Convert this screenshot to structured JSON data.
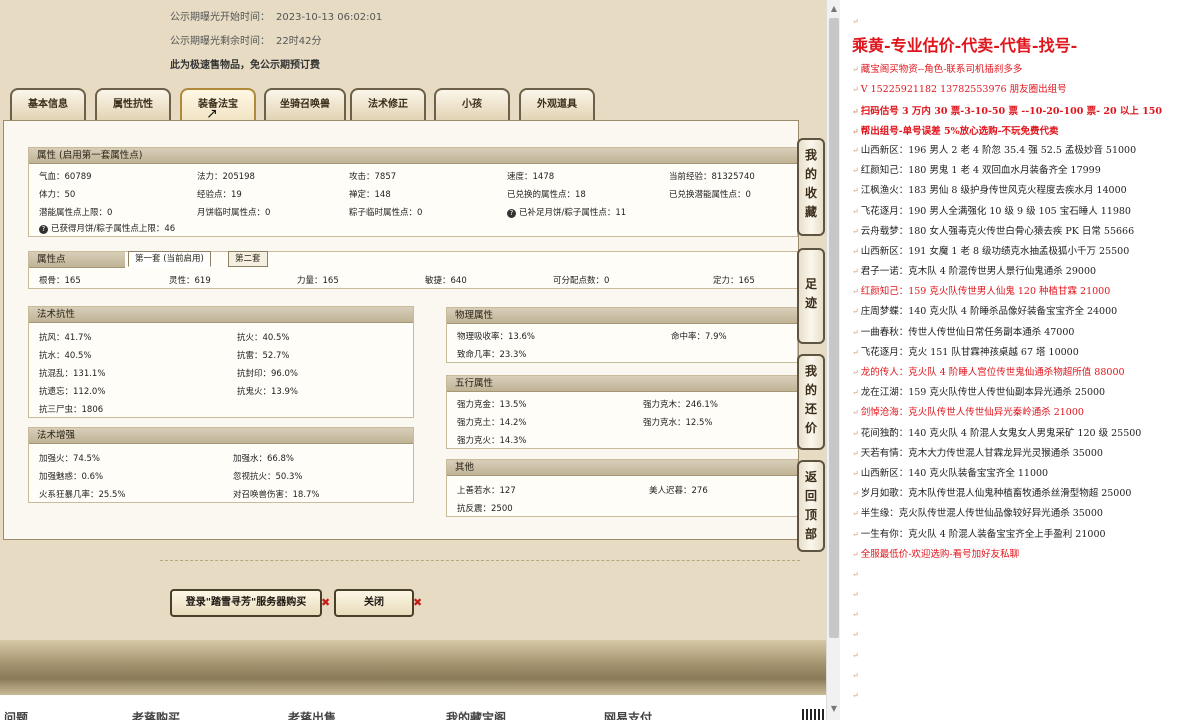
{
  "header": {
    "start_label": "公示期曝光开始时间：",
    "start_value": "2023-10-13 06:02:01",
    "remain_label": "公示期曝光剩余时间：",
    "remain_value": "22时42分",
    "note": "此为极速售物品，免公示期预订费"
  },
  "tabs": [
    "基本信息",
    "属性抗性",
    "装备法宝",
    "坐骑召唤兽",
    "法术修正",
    "小孩",
    "外观道具"
  ],
  "attr": {
    "title": "属性 (启用第一套属性点)",
    "row1": [
      "气血：60789",
      "法力：205198",
      "攻击：7857",
      "速度：1478",
      "当前经验：81325740"
    ],
    "row2": [
      "体力：50",
      "经验点：19",
      "禅定：148",
      "已兑换的属性点：18",
      "已兑换潜能属性点：0"
    ],
    "row3": [
      "潜能属性点上限：0",
      "月饼临时属性点：0",
      "粽子临时属性点：0",
      "已补足月饼/粽子属性点：11"
    ],
    "row4": "已获得月饼/粽子属性点上限：46"
  },
  "points": {
    "title": "属性点",
    "tab1": "第一套 (当前启用)",
    "tab2": "第二套",
    "row": [
      "根骨：165",
      "灵性：619",
      "力量：165",
      "敏捷：640",
      "可分配点数：0",
      "定力：165"
    ]
  },
  "resist": {
    "title": "法术抗性",
    "left": [
      "抗风：41.7%",
      "抗水：40.5%",
      "抗混乱：131.1%",
      "抗遗忘：112.0%",
      "抗三尸虫：1806"
    ],
    "right": [
      "抗火：40.5%",
      "抗雷：52.7%",
      "抗封印：96.0%",
      "抗鬼火：13.9%"
    ]
  },
  "boost": {
    "title": "法术增强",
    "left": [
      "加强火：74.5%",
      "加强魅惑：0.6%",
      "火系狂暴几率：25.5%"
    ],
    "right": [
      "加强水：66.8%",
      "忽视抗火：50.3%",
      "对召唤兽伤害：18.7%"
    ]
  },
  "physical": {
    "title": "物理属性",
    "left": [
      "物理吸收率：13.6%",
      "致命几率：23.3%"
    ],
    "right": [
      "命中率：7.9%"
    ]
  },
  "five": {
    "title": "五行属性",
    "left": [
      "强力克金：13.5%",
      "强力克土：14.2%",
      "强力克火：14.3%"
    ],
    "right": [
      "强力克木：246.1%",
      "强力克水：12.5%"
    ]
  },
  "other": {
    "title": "其他",
    "left": [
      "上善若水：127",
      "抗反震：2500"
    ],
    "right": [
      "美人迟暮：276"
    ]
  },
  "side_buttons": [
    "我的收藏",
    "足迹",
    "我的还价",
    "返回顶部"
  ],
  "buttons": {
    "buy": "登录\"踏雪寻芳\"服务器购买",
    "close": "关闭"
  },
  "footer": [
    "问题",
    "老蒋购买",
    "老蒋出售",
    "我的藏宝阁",
    "网易支付"
  ],
  "right_panel": [
    {
      "text": "",
      "style": "pil"
    },
    {
      "text": "乘黄-专业估价-代卖-代售-找号-",
      "style": "big"
    },
    {
      "text": "藏宝阁买物资--角色-联系司机插刹多多",
      "style": "red"
    },
    {
      "text": "V 15225921182   13782553976 朋友圈出组号",
      "style": "red"
    },
    {
      "text": "扫码估号 3 万内 30 票-3-10-50 票  --10-20-100 票- 20 以上 150",
      "style": "red b"
    },
    {
      "text": "帮出组号-单号误差 5%放心选购-不玩免费代卖",
      "style": "red b"
    },
    {
      "text": "山西新区：196 男人 2 老 4 阶忽 35.4 强 52.5 孟极妙音 51000",
      "style": ""
    },
    {
      "text": "红颜知己：180 男鬼 1 老 4 双回血水月装备齐全 17999",
      "style": ""
    },
    {
      "text": "江枫渔火：183 男仙 8 级护身传世风克火程度去疾水月 14000",
      "style": ""
    },
    {
      "text": "飞花逐月：190 男人全满强化 10 级 9 级 105 宝石睡人 11980",
      "style": ""
    },
    {
      "text": "云舟载梦：180 女人强毒克火传世白骨心猿去疾 PK 日常 55666",
      "style": ""
    },
    {
      "text": "山西新区：191 女魔 1 老 8 级功绩克水抽孟极狐小千万 25500",
      "style": ""
    },
    {
      "text": "君子一诺：克木队 4 阶混传世男人景行仙鬼通杀 29000",
      "style": ""
    },
    {
      "text": "红颜知己：159 克火队传世男人仙鬼 120 种植甘霖 21000",
      "style": "red"
    },
    {
      "text": "庄周梦蝶：140 克火队 4 阶睡杀品像好装备宝宝齐全 24000",
      "style": ""
    },
    {
      "text": "一曲春秋：传世人传世仙日常任务副本通杀 47000",
      "style": ""
    },
    {
      "text": "飞花逐月：克火 151 队甘霖神孩桌越 67 塔 10000",
      "style": ""
    },
    {
      "text": "龙的传人：克火队 4 阶睡人宫位传世鬼仙通杀物超所值 88000",
      "style": "red"
    },
    {
      "text": "龙在江湖：159 克火队传世人传世仙副本异光通杀 25000",
      "style": ""
    },
    {
      "text": "剑悼沧海：克火队传世人传世仙异光秦岭通杀 21000",
      "style": "red"
    },
    {
      "text": "花间独酌：140 克火队 4 阶混人女鬼女人男鬼采矿 120 级 25500",
      "style": ""
    },
    {
      "text": "天若有情：克木大力传世混人甘霖龙异光灵猴通杀 35000",
      "style": ""
    },
    {
      "text": "山西新区：140 克火队装备宝宝齐全 11000",
      "style": ""
    },
    {
      "text": "岁月如歌：克木队传世混人仙鬼种植畜牧通杀丝滑型物超 25000",
      "style": ""
    },
    {
      "text": "半生缘：克火队传世混人传世仙品像较好异光通杀 35000",
      "style": ""
    },
    {
      "text": "一生有你：克火队 4 阶混人装备宝宝齐全上手盈利 21000",
      "style": ""
    },
    {
      "text": "全服最低价-欢迎选购-看号加好友私聊",
      "style": "red"
    },
    {
      "text": "",
      "style": "pil"
    },
    {
      "text": "",
      "style": "pil"
    },
    {
      "text": "",
      "style": "pil"
    },
    {
      "text": "",
      "style": "pil"
    },
    {
      "text": "",
      "style": "pil"
    },
    {
      "text": "",
      "style": "pil"
    },
    {
      "text": "",
      "style": "pil"
    }
  ]
}
